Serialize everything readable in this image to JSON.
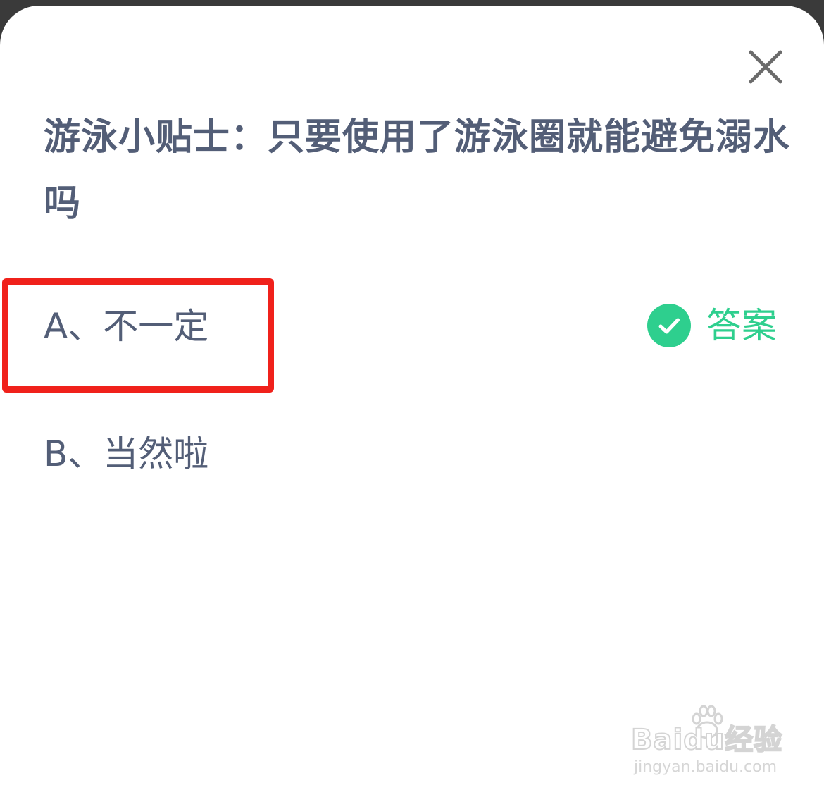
{
  "dialog": {
    "question": "游泳小贴士：只要使用了游泳圈就能避免溺水吗",
    "options": [
      {
        "label": "A、不一定"
      },
      {
        "label": "B、当然啦"
      }
    ],
    "answer_label": "答案",
    "close_icon": "close-icon",
    "check_icon": "check-circle-icon"
  },
  "watermark": {
    "brand": "Baidu经验",
    "url": "jingyan.baidu.com"
  },
  "colors": {
    "question_text": "#535e77",
    "answer_green": "#2ecf8e",
    "highlight_red": "#f0211b"
  }
}
